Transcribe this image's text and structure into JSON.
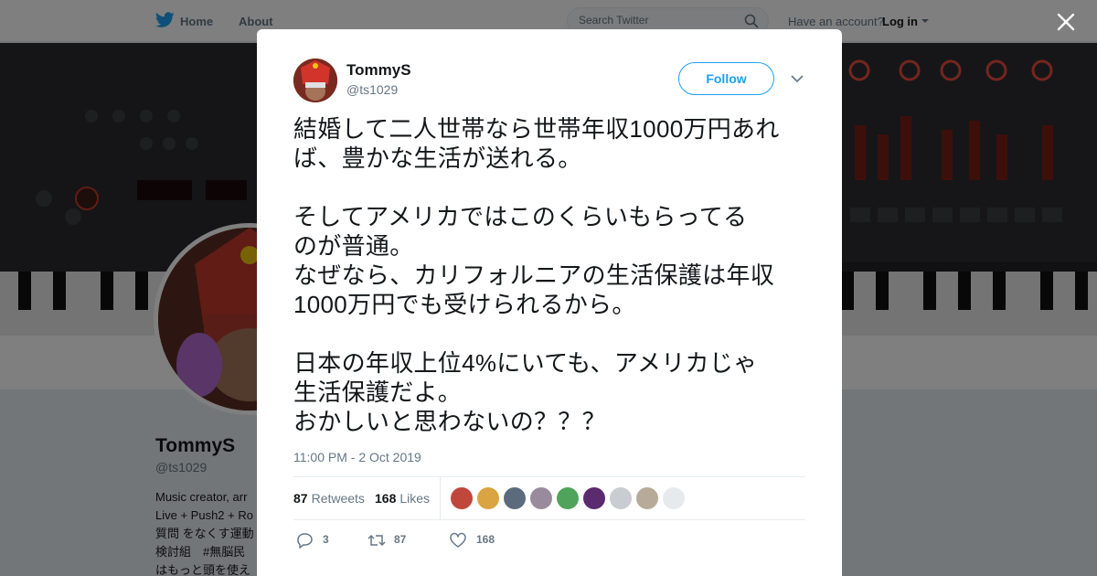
{
  "nav": {
    "home": "Home",
    "about": "About",
    "search_placeholder": "Search Twitter",
    "have_account": "Have an account?",
    "login": "Log in"
  },
  "profile": {
    "name": "TommyS",
    "handle": "@ts1029",
    "bio_lines": [
      "Music creator, arr",
      "Live + Push2 + Ro",
      "質問 をなくす運動",
      "検討組　#無脳民",
      "はもっと頭を使え"
    ]
  },
  "tweet": {
    "author_name": "TommyS",
    "author_handle": "@ts1029",
    "follow_label": "Follow",
    "paragraphs": [
      [
        "結婚して二人世帯なら世帯年収1000万円あれ",
        "ば、豊かな生活が送れる。"
      ],
      [
        "そしてアメリカではこのくらいもらってる",
        "のが普通。",
        "なぜなら、カリフォルニアの生活保護は年収",
        "1000万円でも受けられるから。"
      ],
      [
        "日本の年収上位4%にいても、アメリカじゃ",
        "生活保護だよ。",
        "おかしいと思わないの？？？"
      ]
    ],
    "timestamp": "11:00 PM - 2 Oct 2019",
    "retweets_count": "87",
    "retweets_label": "Retweets",
    "likes_count": "168",
    "likes_label": "Likes",
    "reply_count": "3",
    "retweet_action_count": "87",
    "like_action_count": "168"
  },
  "likers": [
    {
      "icon": "liker-avatar-1-icon",
      "color": "#c0473c"
    },
    {
      "icon": "liker-avatar-2-icon",
      "color": "#d9a441"
    },
    {
      "icon": "liker-avatar-3-icon",
      "color": "#5b6b7c"
    },
    {
      "icon": "liker-avatar-4-icon",
      "color": "#9a8a9e"
    },
    {
      "icon": "liker-avatar-5-icon",
      "color": "#4fa35a"
    },
    {
      "icon": "liker-avatar-6-icon",
      "color": "#5a2b6e"
    },
    {
      "icon": "liker-avatar-7-icon",
      "color": "#c9ccd0"
    },
    {
      "icon": "liker-avatar-8-icon",
      "color": "#b7aa98"
    },
    {
      "icon": "liker-avatar-9-icon",
      "color": "#e7eaed"
    }
  ],
  "colors": {
    "accent": "#1da1f2",
    "text": "#14171a",
    "muted": "#657786"
  }
}
